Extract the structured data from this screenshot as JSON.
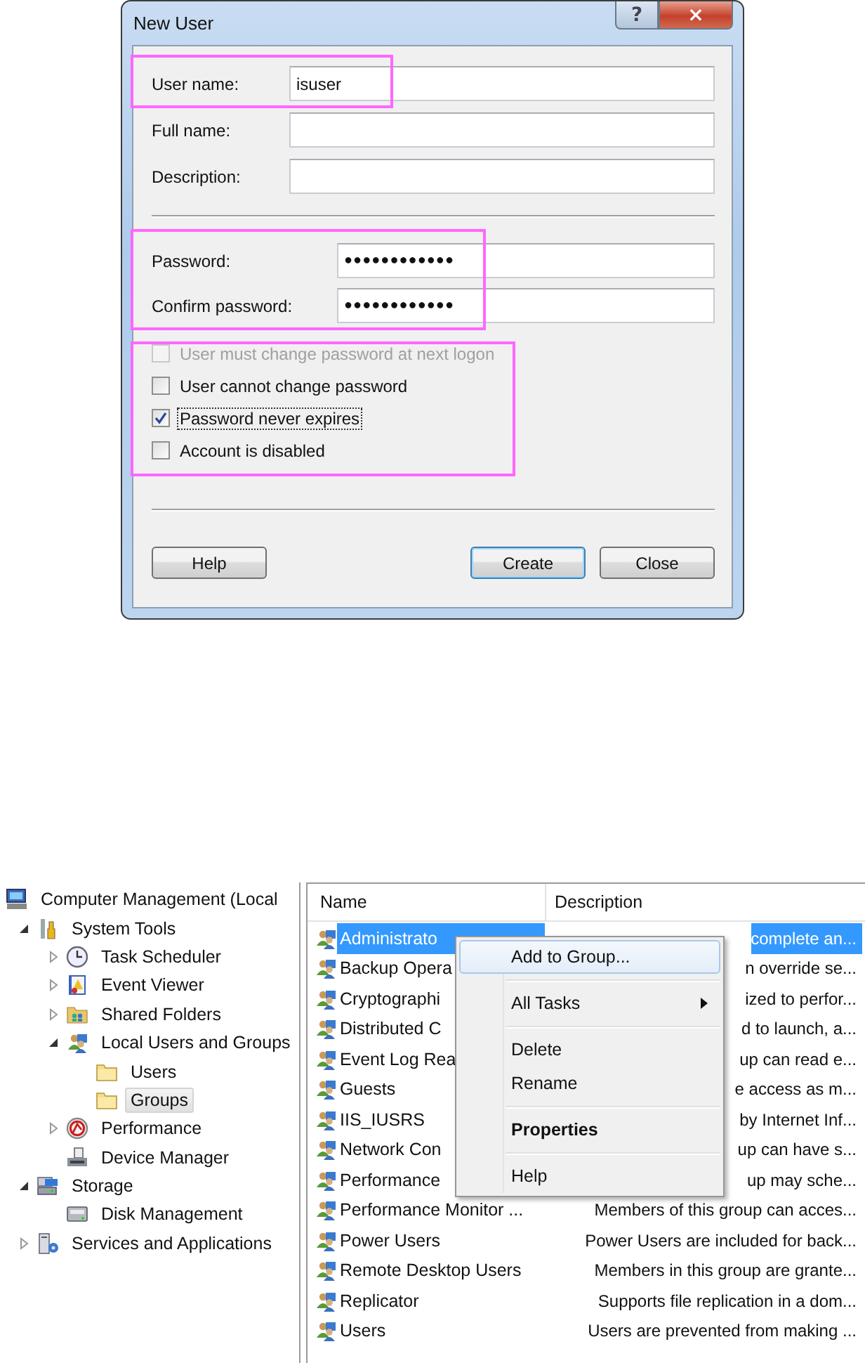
{
  "dialog": {
    "title": "New User",
    "title_buttons": [
      {
        "kind": "help",
        "label": "?"
      },
      {
        "kind": "close",
        "label": "×"
      }
    ],
    "identity_fields": [
      {
        "label": "User name:",
        "value": "isuser"
      },
      {
        "label": "Full name:"
      },
      {
        "label": "Description:"
      }
    ],
    "password_fields": [
      {
        "label": "Password:",
        "value": "●●●●●●●●●●●●"
      },
      {
        "label": "Confirm password:",
        "value": "●●●●●●●●●●●●"
      }
    ],
    "options": [
      {
        "label": "User must change password at next logon",
        "checked": false,
        "disabled": true,
        "focused": false
      },
      {
        "label": "User cannot change password",
        "checked": false,
        "disabled": false,
        "focused": false
      },
      {
        "label": "Password never expires",
        "checked": true,
        "disabled": false,
        "focused": true
      },
      {
        "label": "Account is disabled",
        "checked": false,
        "disabled": false,
        "focused": false
      }
    ],
    "buttons": [
      {
        "label": "Help",
        "default": false
      },
      {
        "label": "Create",
        "default": true
      },
      {
        "label": "Close",
        "default": false
      }
    ]
  },
  "tree": [
    {
      "label": "Computer Management (Local",
      "kind": "computer",
      "selected": false,
      "children": [
        {
          "label": "System Tools",
          "kind": "tools",
          "expanded": true,
          "selected": false,
          "children": [
            {
              "label": "Task Scheduler",
              "kind": "clock",
              "expanded": false,
              "selected": false
            },
            {
              "label": "Event Viewer",
              "kind": "log",
              "expanded": false,
              "selected": false
            },
            {
              "label": "Shared Folders",
              "kind": "share",
              "expanded": false,
              "selected": false
            },
            {
              "label": "Local Users and Groups",
              "kind": "users",
              "expanded": true,
              "selected": false,
              "children": [
                {
                  "label": "Users",
                  "kind": "folder",
                  "selected": false
                },
                {
                  "label": "Groups",
                  "kind": "folder",
                  "selected": true
                }
              ]
            },
            {
              "label": "Performance",
              "kind": "gauge",
              "expanded": false,
              "selected": false
            },
            {
              "label": "Device Manager",
              "kind": "device",
              "selected": false
            }
          ]
        },
        {
          "label": "Storage",
          "kind": "storage",
          "expanded": true,
          "selected": false,
          "children": [
            {
              "label": "Disk Management",
              "kind": "disk",
              "selected": false
            }
          ]
        },
        {
          "label": "Services and Applications",
          "kind": "services",
          "expanded": false,
          "selected": false
        }
      ]
    }
  ],
  "list": {
    "columns": [
      "Name",
      "Description"
    ],
    "rows": [
      {
        "name": "Administrato",
        "description": "complete an...",
        "selected": true
      },
      {
        "name": "Backup Opera",
        "description": "n override se...",
        "selected": false
      },
      {
        "name": "Cryptographi",
        "description": "ized to perfor...",
        "selected": false
      },
      {
        "name": "Distributed C",
        "description": "d to launch, a...",
        "selected": false
      },
      {
        "name": "Event Log Rea",
        "description": "up can read e...",
        "selected": false
      },
      {
        "name": "Guests",
        "description": "e access as m...",
        "selected": false
      },
      {
        "name": "IIS_IUSRS",
        "description": "by Internet Inf...",
        "selected": false
      },
      {
        "name": "Network Con",
        "description": "up can have s...",
        "selected": false
      },
      {
        "name": "Performance",
        "description": "up may sche...",
        "selected": false
      },
      {
        "name": "Performance Monitor ...",
        "description": "Members of this group can acces...",
        "selected": false
      },
      {
        "name": "Power Users",
        "description": "Power Users are included for back...",
        "selected": false
      },
      {
        "name": "Remote Desktop Users",
        "description": "Members in this group are grante...",
        "selected": false
      },
      {
        "name": "Replicator",
        "description": "Supports file replication in a dom...",
        "selected": false
      },
      {
        "name": "Users",
        "description": "Users are prevented from making ...",
        "selected": false
      }
    ]
  },
  "context_menu": {
    "items": [
      {
        "kind": "item",
        "label": "Add to Group...",
        "highlighted": true,
        "bold": false,
        "submenu": false
      },
      {
        "kind": "separator"
      },
      {
        "kind": "item",
        "label": "All Tasks",
        "highlighted": false,
        "bold": false,
        "submenu": true
      },
      {
        "kind": "separator"
      },
      {
        "kind": "item",
        "label": "Delete",
        "highlighted": false,
        "bold": false,
        "submenu": false
      },
      {
        "kind": "item",
        "label": "Rename",
        "highlighted": false,
        "bold": false,
        "submenu": false
      },
      {
        "kind": "separator"
      },
      {
        "kind": "item",
        "label": "Properties",
        "highlighted": false,
        "bold": true,
        "submenu": false
      },
      {
        "kind": "separator"
      },
      {
        "kind": "item",
        "label": "Help",
        "highlighted": false,
        "bold": false,
        "submenu": false
      }
    ]
  }
}
